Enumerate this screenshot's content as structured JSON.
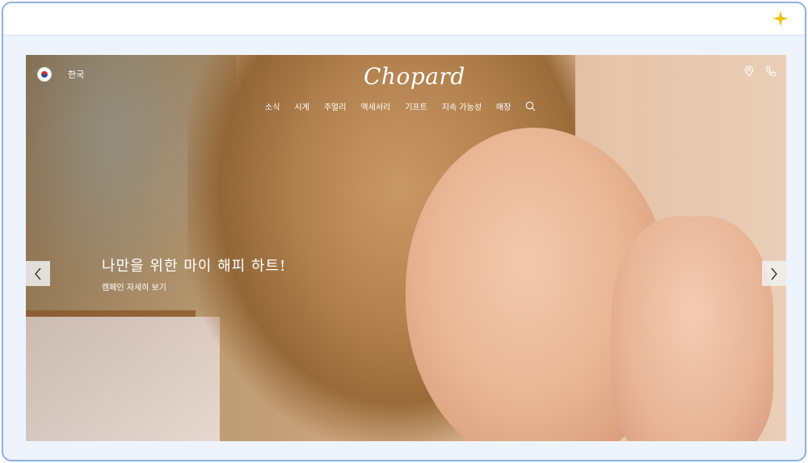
{
  "header": {
    "language_label": "한국",
    "logo_text": "Chopard"
  },
  "nav": {
    "items": [
      {
        "label": "소식"
      },
      {
        "label": "시계"
      },
      {
        "label": "주얼리"
      },
      {
        "label": "액세서리"
      },
      {
        "label": "기프트"
      },
      {
        "label": "지속 가능성"
      },
      {
        "label": "매장"
      }
    ]
  },
  "hero": {
    "headline": "나만을 위한 마이 해피 하트!",
    "cta": "캠페인 자세히 보기"
  },
  "colors": {
    "frame_border": "#8fb0de",
    "sparkle": "#f2c200"
  },
  "icons": {
    "flag": "korea-flag-icon",
    "location": "location-pin-icon",
    "phone": "phone-icon",
    "search": "search-icon",
    "prev": "chevron-left-icon",
    "next": "chevron-right-icon",
    "sparkle": "sparkle-icon"
  }
}
